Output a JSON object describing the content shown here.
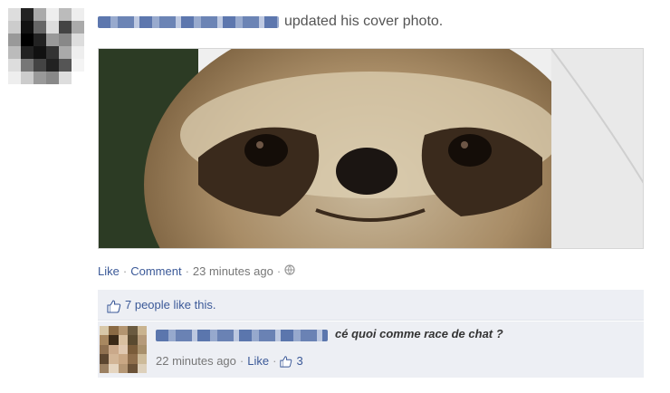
{
  "story": {
    "action_text": "updated his cover photo.",
    "actions": {
      "like": "Like",
      "comment": "Comment",
      "timestamp": "23 minutes ago"
    }
  },
  "likes": {
    "summary": "7 people like this."
  },
  "comment": {
    "text": "cé quoi comme race de chat ?",
    "timestamp": "22 minutes ago",
    "like": "Like",
    "like_count": "3"
  },
  "colors": {
    "link": "#3b5998",
    "feedback_bg": "#edeff4",
    "meta": "#777777"
  },
  "icons": [
    "globe-icon",
    "thumbs-up-icon"
  ]
}
